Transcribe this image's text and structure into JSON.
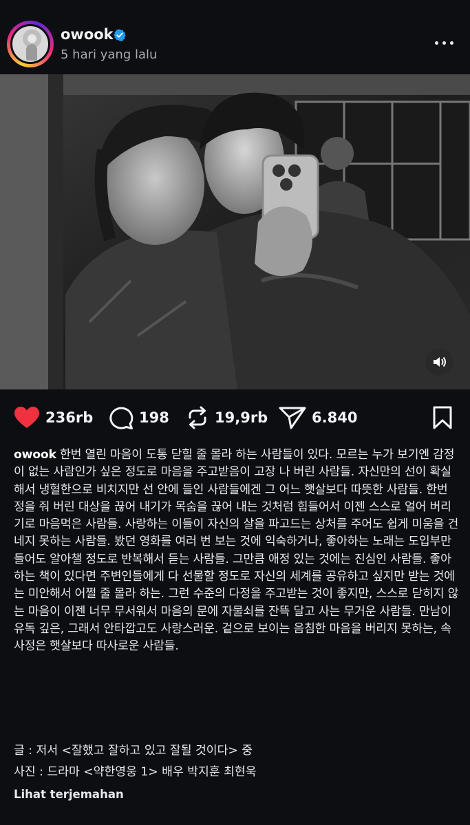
{
  "post": {
    "username": "owook",
    "verified": true,
    "timestamp": "5 hari yang lalu"
  },
  "stats": {
    "likes": "236rb",
    "comments": "198",
    "reposts": "19,9rb",
    "shares": "6.840"
  },
  "caption": {
    "username": "owook",
    "text": "한번 열린 마음이 도통 닫힐 줄 몰라 하는 사람들이 있다. 모르는 누가 보기엔 감정이 없는 사람인가 싶은 정도로 마음을 주고받음이 고장 나 버린 사람들. 자신만의 선이 확실해서 냉혈한으로 비치지만 선 안에 들인 사람들에겐 그 어느 햇살보다 따뜻한 사람들. 한번 정을 줘 버린 대상을 끊어 내기가 목숨을 끊어 내는 것처럼 힘들어서 이젠 스스로 얼어 버리기로 마음먹은 사람들. 사랑하는 이들이 자신의 살을 파고드는 상처를 주어도 쉽게 미움을 건네지 못하는 사람들. 봤던 영화를 여러 번 보는 것에 익숙하거나, 좋아하는 노래는 도입부만 들어도 알아챌 정도로 반복해서 듣는 사람들. 그만큼 애정 있는 것에는 진심인 사람들. 좋아하는 책이 있다면 주변인들에게 다 선물할 정도로 자신의 세계를 공유하고 싶지만 받는 것에는 미안해서 어쩔 줄 몰라 하는. 그런 수준의 다정을 주고받는 것이 좋지만, 스스로 닫히지 않는 마음이 이젠 너무 무서워서 마음의 문에 자물쇠를 잔뜩 달고 사는 무거운 사람들. 만남이 유독 깊은, 그래서 안타깝고도 사랑스러운. 겉으로 보이는 음침한 마음을 버리지 못하는, 속사정은 햇살보다 따사로운 사람들.",
    "credit_text": "글 : 저서 <잘했고 잘하고 있고 잘될 것이다> 중",
    "credit_photo": "사진 : 드라마 <약한영웅 1> 배우 박지훈 최현욱",
    "translate_label": "Lihat terjemahan"
  },
  "colors": {
    "background": "#0c0e12",
    "like": "#f0313f",
    "verified": "#1d9bf0",
    "text": "#f2f3f5",
    "muted": "#a9acb3"
  },
  "icons": {
    "like": "heart-filled-icon",
    "comment": "speech-bubble-icon",
    "repost": "repost-arrows-icon",
    "share": "paper-plane-icon",
    "save": "bookmark-icon",
    "sound": "speaker-icon",
    "more": "ellipsis-icon",
    "verified": "verified-badge-icon"
  }
}
